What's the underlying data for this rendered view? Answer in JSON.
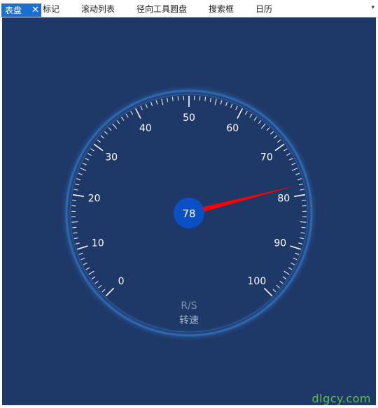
{
  "tabs": [
    {
      "label": "表盘",
      "active": true
    },
    {
      "label": "标记",
      "active": false
    },
    {
      "label": "滚动列表",
      "active": false
    },
    {
      "label": "径向工具圆盘",
      "active": false
    },
    {
      "label": "搜索框",
      "active": false
    },
    {
      "label": "日历",
      "active": false
    }
  ],
  "tab_close_glyph": "✕",
  "tab_overflow_glyph": "▾",
  "gauge": {
    "min": 0,
    "max": 100,
    "value": 78,
    "value_label": "78",
    "unit_label": "R/S",
    "title_label": "转速",
    "tick_labels": [
      "0",
      "10",
      "20",
      "30",
      "40",
      "50",
      "60",
      "70",
      "80",
      "90",
      "100"
    ],
    "colors": {
      "background": "#1e3867",
      "ring": "#2f6bb4",
      "needle": "#ff0000",
      "hub": "#0a4fc4",
      "text": "#ffffff",
      "unit_text": "#7f93b6"
    }
  },
  "watermark": "dlgcy.com"
}
